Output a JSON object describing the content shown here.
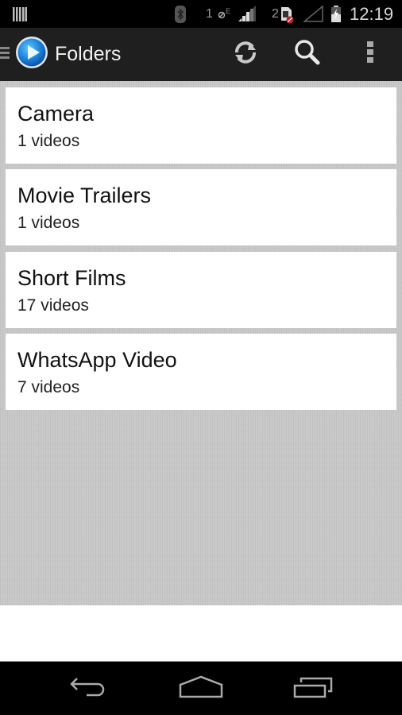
{
  "status_bar": {
    "time": "12:19",
    "sim1_label": "1",
    "sim2_label": "2",
    "icons": [
      "notification-icon",
      "bluetooth-icon",
      "data-blocked-icon",
      "signal-icon",
      "sim-blocked-icon",
      "signal-empty-icon",
      "battery-charging-icon"
    ]
  },
  "action_bar": {
    "title": "Folders",
    "actions": [
      "refresh",
      "search",
      "overflow-menu"
    ]
  },
  "folders": [
    {
      "name": "Camera",
      "count": "1 videos"
    },
    {
      "name": "Movie Trailers",
      "count": "1 videos"
    },
    {
      "name": "Short Films",
      "count": "17 videos"
    },
    {
      "name": "WhatsApp Video",
      "count": "7 videos"
    }
  ],
  "nav_bar": {
    "buttons": [
      "back",
      "home",
      "recents"
    ]
  }
}
